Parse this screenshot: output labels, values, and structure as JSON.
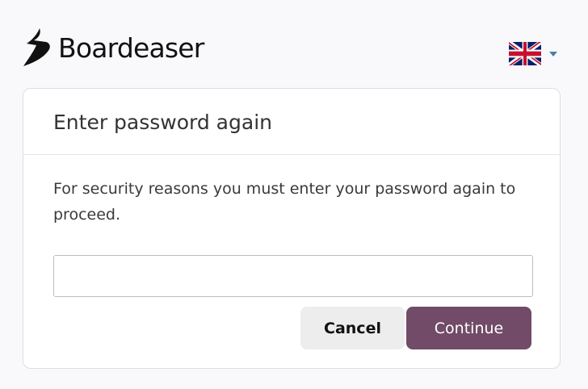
{
  "brand": {
    "name": "Boardeaser",
    "logo_icon": "boardeaser-logo-icon"
  },
  "language_selector": {
    "flag": "uk-flag-icon",
    "caret": "caret-down-icon"
  },
  "dialog": {
    "title": "Enter password again",
    "message": "For security reasons you must enter your password again to proceed.",
    "password_field": {
      "value": "",
      "placeholder": ""
    },
    "cancel_label": "Cancel",
    "continue_label": "Continue"
  },
  "colors": {
    "primary": "#714b67",
    "secondary_button": "#ededed",
    "page_background": "#f9f9fb",
    "caret": "#4a7fa7"
  }
}
